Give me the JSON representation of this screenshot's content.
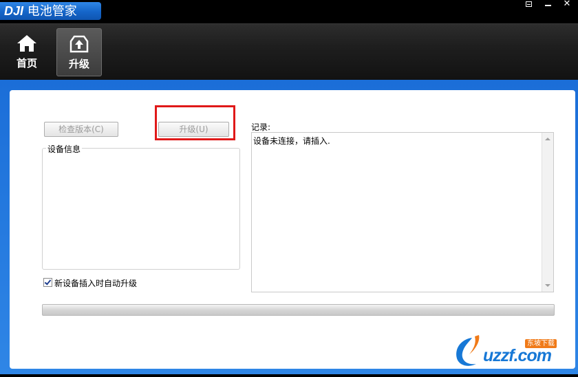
{
  "window": {
    "brand": "DJI",
    "title": "电池管家",
    "controls": {
      "menu_icon": "dropdown-icon",
      "min_icon": "minimize-icon",
      "close_icon": "close-icon"
    }
  },
  "toolbar": {
    "items": [
      {
        "label": "首页",
        "icon": "home-icon",
        "active": false
      },
      {
        "label": "升级",
        "icon": "upload-icon",
        "active": true
      }
    ]
  },
  "upgrade_panel": {
    "check_version_button": "检查版本(C)",
    "upgrade_button": "升级(U)",
    "device_info_label": "设备信息",
    "auto_upgrade_label": "新设备插入时自动升级",
    "auto_upgrade_checked": true,
    "log_label": "记录:",
    "log_text": "设备未连接，请插入.",
    "progress": 0
  },
  "watermark": {
    "text": "uzzf.com",
    "badge": "东坡下载"
  },
  "colors": {
    "accent_blue": "#1e72da",
    "highlight_red": "#e01919"
  }
}
